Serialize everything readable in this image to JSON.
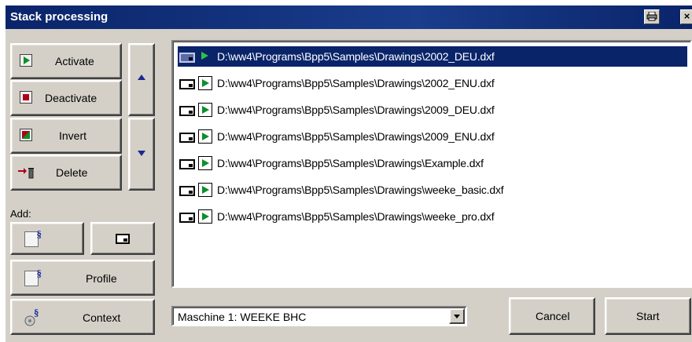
{
  "window": {
    "title": "Stack processing"
  },
  "left_buttons": {
    "activate": "Activate",
    "deactivate": "Deactivate",
    "invert": "Invert",
    "delete": "Delete"
  },
  "add": {
    "label": "Add:",
    "profile": "Profile",
    "context": "Context"
  },
  "file_list": {
    "items": [
      "D:\\ww4\\Programs\\Bpp5\\Samples\\Drawings\\2002_DEU.dxf",
      "D:\\ww4\\Programs\\Bpp5\\Samples\\Drawings\\2002_ENU.dxf",
      "D:\\ww4\\Programs\\Bpp5\\Samples\\Drawings\\2009_DEU.dxf",
      "D:\\ww4\\Programs\\Bpp5\\Samples\\Drawings\\2009_ENU.dxf",
      "D:\\ww4\\Programs\\Bpp5\\Samples\\Drawings\\Example.dxf",
      "D:\\ww4\\Programs\\Bpp5\\Samples\\Drawings\\weeke_basic.dxf",
      "D:\\ww4\\Programs\\Bpp5\\Samples\\Drawings\\weeke_pro.dxf"
    ],
    "selected_index": 0
  },
  "machine": {
    "selected": "Maschine 1: WEEKE BHC"
  },
  "footer": {
    "cancel": "Cancel",
    "start": "Start"
  },
  "icons": {
    "activate": "play-icon",
    "deactivate": "stop-icon",
    "invert": "invert-icon",
    "delete": "delete-icon",
    "move_up": "arrow-up-icon",
    "move_down": "arrow-down-icon",
    "add_profile": "profile-doc-icon",
    "add_drawing": "drawing-icon",
    "context": "context-icon",
    "print": "print-icon",
    "close": "close-icon"
  },
  "colors": {
    "title_bar": "#0a246a",
    "selection": "#0a246a",
    "face": "#d4d0c8",
    "active_green": "#0d8f2a",
    "stop_red": "#b00018"
  }
}
